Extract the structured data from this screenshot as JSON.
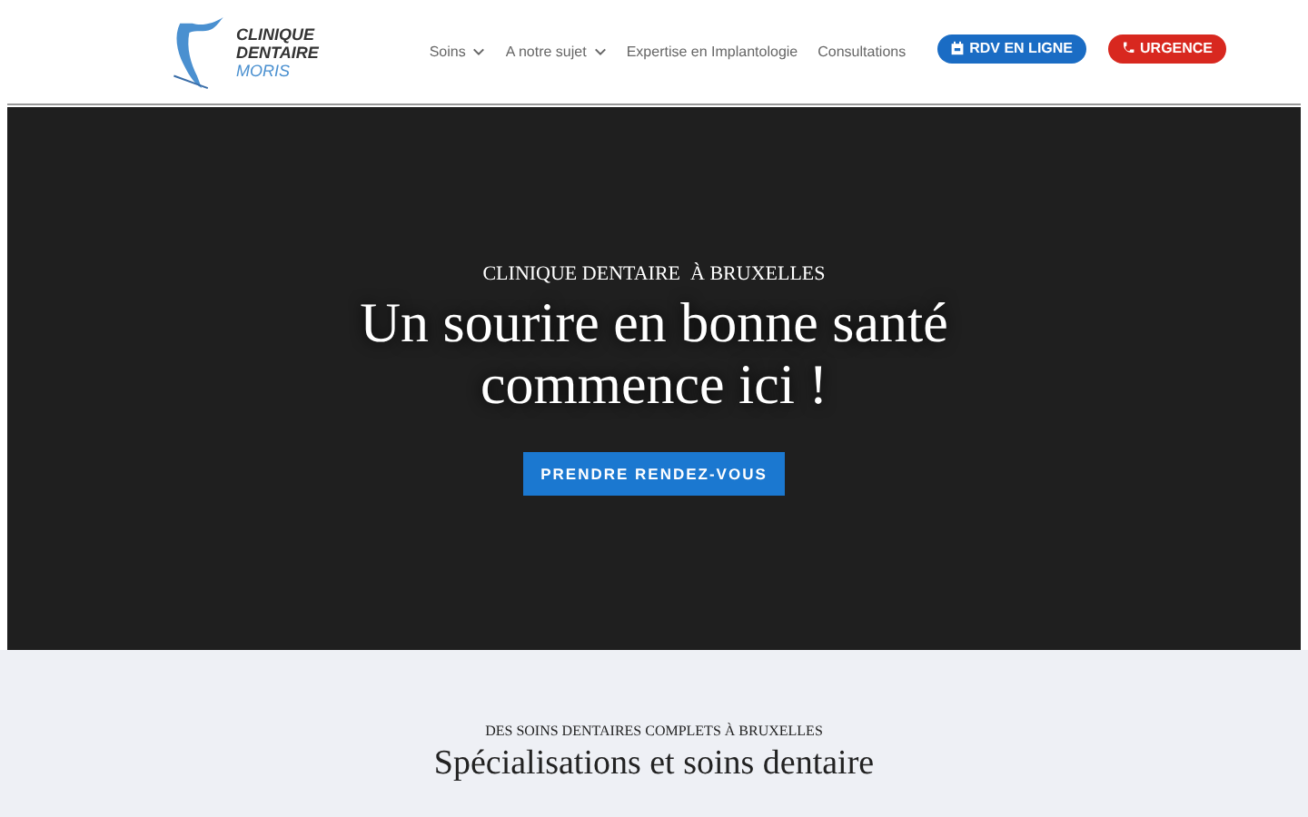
{
  "logo": {
    "lines": [
      "CLINIQUE",
      "DENTAIRE",
      "MORIS"
    ]
  },
  "nav": [
    {
      "label": "Soins",
      "has_dropdown": true
    },
    {
      "label": "A notre sujet",
      "has_dropdown": true
    },
    {
      "label": "Expertise en Implantologie",
      "has_dropdown": false
    },
    {
      "label": "Consultations",
      "has_dropdown": false
    }
  ],
  "header_buttons": [
    {
      "kind": "booking",
      "label": "RDV EN LIGNE"
    },
    {
      "kind": "emergency",
      "label": "URGENCE"
    }
  ],
  "hero": {
    "kicker": "CLINIQUE DENTAIRE  À BRUXELLES",
    "title": "Un sourire en bonne santé commence ici !",
    "button": "PRENDRE RENDEZ-VOUS"
  },
  "section": {
    "kicker": "DES SOINS DENTAIRES COMPLETS À BRUXELLES",
    "title": "Spécialisations et soins dentaire"
  }
}
